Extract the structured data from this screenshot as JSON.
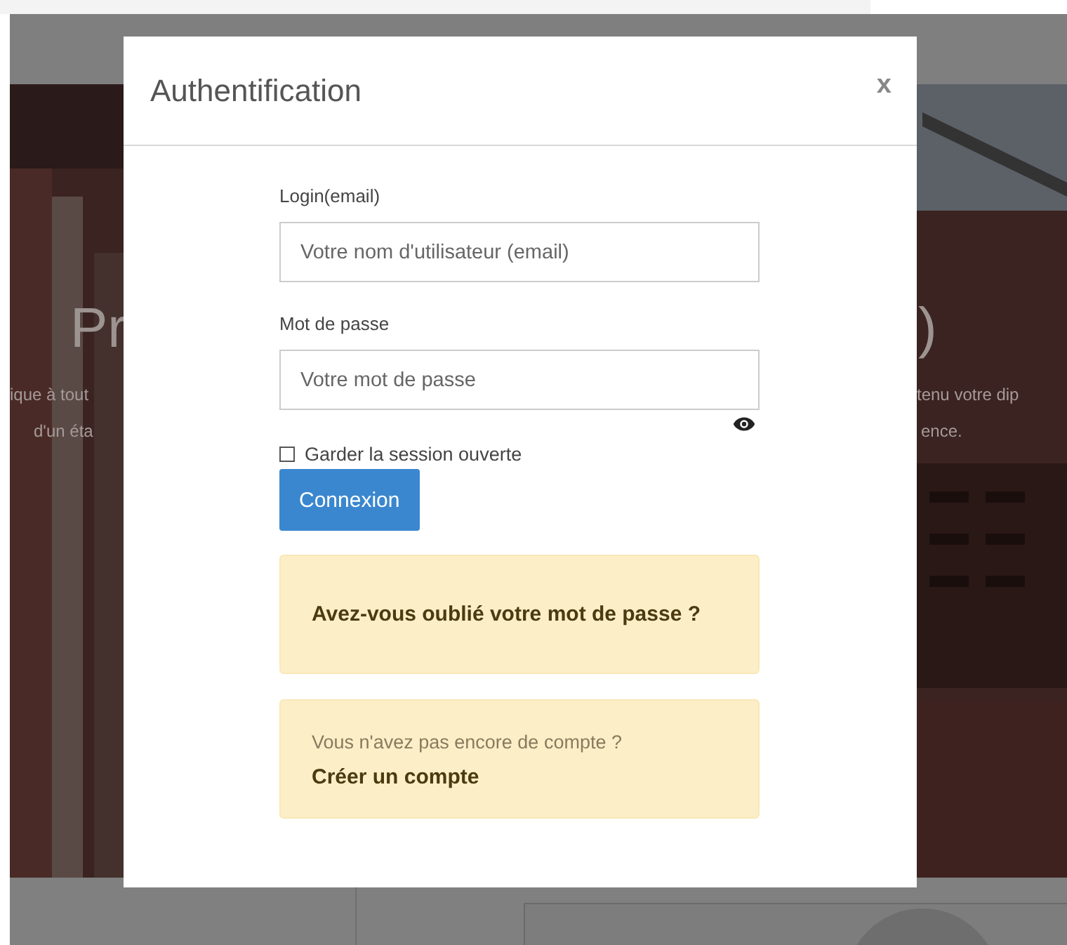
{
  "background": {
    "left_texts": [
      "Pr",
      "ique à tout",
      "d'un éta"
    ],
    "right_texts": [
      ")",
      "tenu votre dip",
      "ence."
    ]
  },
  "modal": {
    "title": "Authentification",
    "close": "x",
    "fields": [
      {
        "label": "Login(email)",
        "placeholder": "Votre nom d'utilisateur (email)",
        "kind": "text"
      },
      {
        "label": "Mot de passe",
        "placeholder": "Votre mot de passe",
        "kind": "password"
      }
    ],
    "remember": {
      "label": "Garder la session ouverte",
      "checked": false
    },
    "submit": "Connexion",
    "forgot": "Avez-vous oublié votre mot de passe ?",
    "signup": {
      "prompt": "Vous n'avez pas encore de compte ?",
      "link": "Créer un compte"
    }
  }
}
